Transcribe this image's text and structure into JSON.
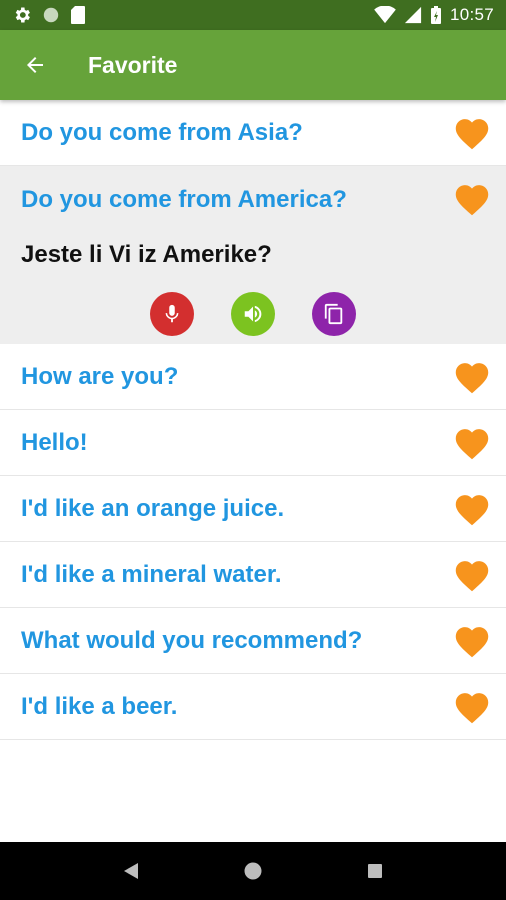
{
  "status_bar": {
    "time": "10:57",
    "icons": [
      "gear-icon",
      "circle-icon",
      "sd-card-icon",
      "wifi-icon",
      "signal-icon",
      "battery-icon"
    ]
  },
  "app_bar": {
    "title": "Favorite",
    "back_icon": "arrow-back-icon",
    "background": "#66a33a"
  },
  "favorites": [
    {
      "phrase": "Do you come from Asia?"
    },
    {
      "phrase": "Do you come from America?",
      "translation": "Jeste li Vi iz Amerike?",
      "expanded": true
    },
    {
      "phrase": "How are you?"
    },
    {
      "phrase": "Hello!"
    },
    {
      "phrase": "I'd like an orange juice."
    },
    {
      "phrase": "I'd like a mineral water."
    },
    {
      "phrase": "What would you recommend?"
    },
    {
      "phrase": "I'd like a beer."
    }
  ],
  "actions": [
    {
      "icon": "microphone-icon",
      "color": "#d32f2f"
    },
    {
      "icon": "speaker-icon",
      "color": "#7cc320"
    },
    {
      "icon": "copy-icon",
      "color": "#8e24aa"
    }
  ],
  "colors": {
    "phrase_text": "#2196e0",
    "heart": "#f7941d",
    "expanded_bg": "#eeeeee"
  },
  "nav_bar": {
    "icons": [
      "back-triangle-icon",
      "home-circle-icon",
      "recents-square-icon"
    ]
  }
}
